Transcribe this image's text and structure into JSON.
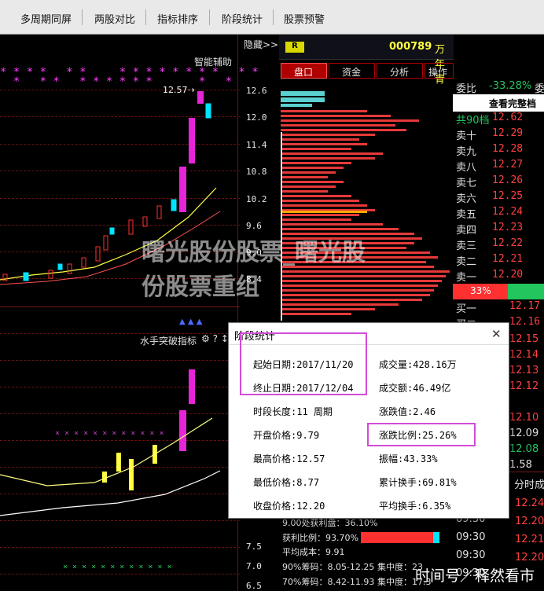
{
  "toolbar": {
    "items": [
      "多周期同屏",
      "两股对比",
      "指标排序",
      "阶段统计",
      "股票预警"
    ],
    "hide_label": "隐藏>>"
  },
  "colors": {
    "up": "#ff3030",
    "down": "#00e5ff",
    "magenta": "#e824d8",
    "yellow": "#ffff40",
    "highlight": "#d24bd6",
    "green": "#22c55e"
  },
  "main_chart": {
    "smart_assist": "智能辅助",
    "peak_label": "12.57→",
    "indicator_name": "水手突破指标",
    "indicator_icons": "⚙ ? ↕",
    "star_row_1": "* * * *   * *     * * * * * * * *   * *      *",
    "star_row_2": "  *   * *   * * * * * *       *   *",
    "price_ticks": [
      "12.6",
      "12.0",
      "11.4",
      "10.8",
      "10.2",
      "9.6",
      "9.0",
      "8.4"
    ],
    "lower_ticks": [
      "7.5",
      "7.0",
      "6.5"
    ]
  },
  "stock": {
    "badge": "R",
    "code": "000789",
    "name": "万年青"
  },
  "tabs": [
    "盘口",
    "资金",
    "分析",
    "操作"
  ],
  "chip_panel": {
    "profit_text": "9.00处获利盘：36.10%",
    "profit_ratio_label": "获利比例：93.70%",
    "avg_cost": "平均成本：9.91",
    "chips_90": "90%筹码：8.05-12.25",
    "concentration_90": "集中度：23",
    "chips_70": "70%筹码：8.42-11.93",
    "concentration_70": "集中度：17.3"
  },
  "order_book": {
    "weibi_label": "委比",
    "weibi_value": "-33.28%",
    "weibi_tail": "委",
    "view_full": "查看完整档",
    "rows": [
      {
        "label": "共90档",
        "price": "12.62"
      },
      {
        "label": "卖十",
        "price": "12.29"
      },
      {
        "label": "卖九",
        "price": "12.28"
      },
      {
        "label": "卖八",
        "price": "12.27"
      },
      {
        "label": "卖七",
        "price": "12.26"
      },
      {
        "label": "卖六",
        "price": "12.25"
      },
      {
        "label": "卖五",
        "price": "12.24"
      },
      {
        "label": "卖四",
        "price": "12.23"
      },
      {
        "label": "卖三",
        "price": "12.22"
      },
      {
        "label": "卖二",
        "price": "12.21"
      },
      {
        "label": "卖一",
        "price": "12.20"
      }
    ],
    "ratio": "33%",
    "buy_rows": [
      {
        "label": "买一",
        "price": "12.17"
      },
      {
        "label": "买二",
        "price": "12.16"
      }
    ],
    "side_prices": [
      "12.15",
      "12.14",
      "12.13",
      "12.12",
      "12.10",
      "12.09",
      "12.08",
      "1.58"
    ],
    "tick_header": "分时成交",
    "ticks": [
      {
        "time": "09:30",
        "price": "12.24"
      },
      {
        "time": "09:30",
        "price": "12.20"
      },
      {
        "time": "09:30",
        "price": "12.21"
      },
      {
        "time": "09:30",
        "price": "12.20"
      }
    ]
  },
  "dialog": {
    "title": "阶段统计",
    "close": "✕",
    "left": [
      "起始日期:2017/11/20",
      "终止日期:2017/12/04",
      "时段长度:11 周期",
      "开盘价格:9.79",
      "最高价格:12.57",
      "最低价格:8.77",
      "收盘价格:12.20"
    ],
    "right": [
      "成交量:428.16万",
      "成交额:46.49亿",
      "涨跌值:2.46",
      "涨跌比例:25.26%",
      "振幅:43.33%",
      "累计换手:69.81%",
      "平均换手:6.35%"
    ]
  },
  "watermark": {
    "line1": "曙光股份股票_曙光股",
    "line2": "份股票重组"
  },
  "corner_watermark": "时间号／释然看市"
}
